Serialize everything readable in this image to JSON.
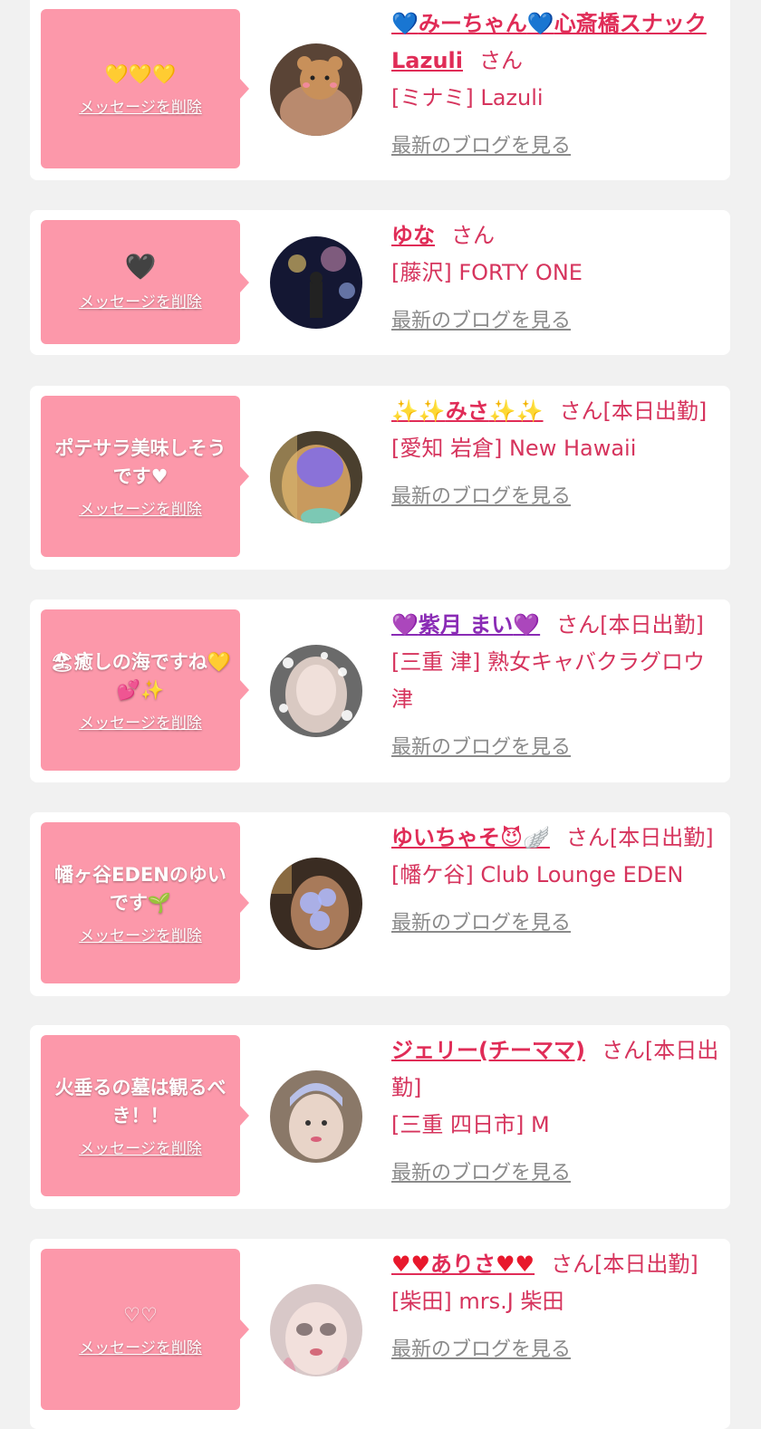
{
  "entries": [
    {
      "message": "💛💛💛",
      "delete_label": "メッセージを削除",
      "name_prefix": "💙",
      "name": "みーちゃん",
      "name_mid": "💙",
      "name_rest": "心斎橋スナックLazuli",
      "name_suffix": "",
      "honorific": "さん",
      "shop": "[ミナミ] Lazuli",
      "blog_label": "最新のブログを見る"
    },
    {
      "message": "🖤",
      "delete_label": "メッセージを削除",
      "name_prefix": "",
      "name": "ゆな",
      "name_mid": "",
      "name_rest": "",
      "name_suffix": "",
      "honorific": "さん",
      "shop": "[藤沢] FORTY ONE",
      "blog_label": "最新のブログを見る"
    },
    {
      "message": "ポテサラ美味しそうです♥",
      "delete_label": "メッセージを削除",
      "name_prefix": "✨✨",
      "name": "みさ",
      "name_mid": "",
      "name_rest": "",
      "name_suffix": "✨✨",
      "honorific": "さん[本日出勤]",
      "shop": "[愛知 岩倉] New Hawaii",
      "blog_label": "最新のブログを見る"
    },
    {
      "message": "🏖癒しの海ですね💛💕✨",
      "delete_label": "メッセージを削除",
      "name_prefix": "💜",
      "name": "紫月 まい",
      "name_mid": "",
      "name_rest": "",
      "name_suffix": "💜",
      "honorific": "さん[本日出勤]",
      "shop": "[三重 津] 熟女キャバクラグロウ津",
      "blog_label": "最新のブログを見る"
    },
    {
      "message": "幡ヶ谷EDENのゆいです🌱",
      "delete_label": "メッセージを削除",
      "name_prefix": "",
      "name": "ゆいちゃそ",
      "name_mid": "",
      "name_rest": "",
      "name_suffix": "😈🪽",
      "honorific": "さん[本日出勤]",
      "shop": "[幡ケ谷] Club Lounge EDEN",
      "blog_label": "最新のブログを見る"
    },
    {
      "message": "火垂るの墓は観るべき！！",
      "delete_label": "メッセージを削除",
      "name_prefix": "",
      "name": "ジェリー(チーママ)",
      "name_mid": "",
      "name_rest": "",
      "name_suffix": "",
      "honorific": "さん[本日出勤]",
      "shop": "[三重 四日市] M",
      "blog_label": "最新のブログを見る"
    },
    {
      "message": "♡♡",
      "delete_label": "メッセージを削除",
      "name_prefix": "♥♥",
      "name": "ありさ",
      "name_mid": "",
      "name_rest": "",
      "name_suffix": "♥♥",
      "honorific": "さん[本日出勤]",
      "shop": "[柴田] mrs.J 柴田",
      "blog_label": "最新のブログを見る"
    }
  ]
}
